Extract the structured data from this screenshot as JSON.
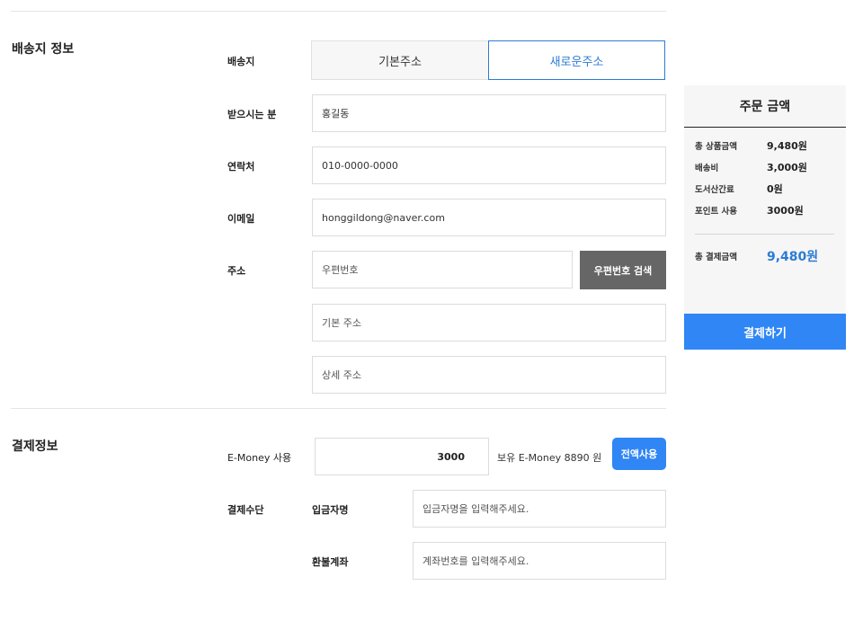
{
  "shipping": {
    "section_title": "배송지 정보",
    "destination_label": "배송지",
    "tabs": [
      {
        "label": "기본주소",
        "active": false
      },
      {
        "label": "새로운주소",
        "active": true
      }
    ],
    "recipient_label": "받으시는 분",
    "recipient_value": "홍길동",
    "phone_label": "연락처",
    "phone_value": "010-0000-0000",
    "email_label": "이메일",
    "email_value": "honggildong@naver.com",
    "address_label": "주소",
    "postcode_placeholder": "우편번호",
    "postcode_search_button": "우편번호 검색",
    "base_address_placeholder": "기본 주소",
    "detail_address_placeholder": "상세 주소"
  },
  "payment": {
    "section_title": "결제정보",
    "emoney_label": "E-Money 사용",
    "emoney_value": "3000",
    "emoney_balance_text": "보유 E-Money 8890 원",
    "use_all_button": "전액사용",
    "method_label": "결제수단",
    "depositor_label": "입금자명",
    "depositor_placeholder": "입금자명을 입력해주세요.",
    "refund_label": "환불계좌",
    "refund_placeholder": "계좌번호를 입력해주세요."
  },
  "summary": {
    "title": "주문 금액",
    "rows": [
      {
        "label": "총 상품금액",
        "value": "9,480원"
      },
      {
        "label": "배송비",
        "value": "3,000원"
      },
      {
        "label": "도서산간료",
        "value": "0원"
      },
      {
        "label": "포인트 사용",
        "value": "3000원"
      }
    ],
    "total_label": "총 결제금액",
    "total_value": "9,480원",
    "pay_button": "결제하기"
  },
  "colors": {
    "accent": "#2f86f4",
    "accent_text": "#2b7cd3",
    "dark_button": "#666666",
    "panel_bg": "#f6f6f6"
  }
}
